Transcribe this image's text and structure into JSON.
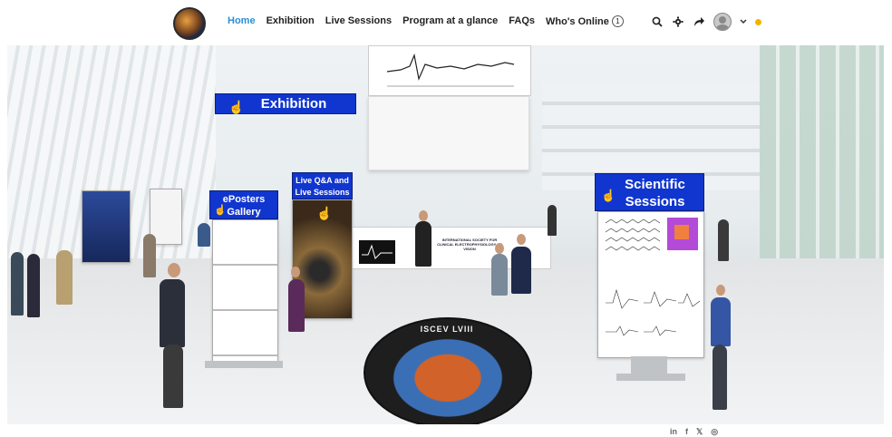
{
  "nav": {
    "items": [
      {
        "label": "Home",
        "active": true
      },
      {
        "label": "Exhibition",
        "active": false
      },
      {
        "label": "Live Sessions",
        "active": false
      },
      {
        "label": "Program at a glance",
        "active": false
      },
      {
        "label": "FAQs",
        "active": false
      },
      {
        "label": "Who's Online",
        "active": false
      }
    ],
    "online_count": "1"
  },
  "toolbar": {
    "icons": [
      "search-icon",
      "gear-icon",
      "share-icon",
      "avatar",
      "chevron-down-icon",
      "notification-dot"
    ]
  },
  "scene": {
    "exhibition_label": "Exhibition",
    "eposters_label_line1": "ePosters",
    "eposters_label_line2": "Gallery",
    "live_label_line1": "Live Q&A and",
    "live_label_line2": "Live Sessions",
    "scientific_label_line1": "Scientific",
    "scientific_label_line2": "Sessions",
    "booth_text": "INTERNATIONAL SOCIETY FOR CLINICAL ELECTROPHYSIOLOGY OF VISION",
    "emblem_text": "ISCEV LVIII"
  },
  "social": {
    "icons": [
      "linkedin-icon",
      "facebook-icon",
      "twitter-icon",
      "instagram-icon"
    ],
    "labels": [
      "in",
      "f",
      "𝕏",
      "◎"
    ]
  },
  "colors": {
    "accent": "#2a8fd6",
    "label_blue": "#1136cf",
    "notification": "#f0b400"
  }
}
